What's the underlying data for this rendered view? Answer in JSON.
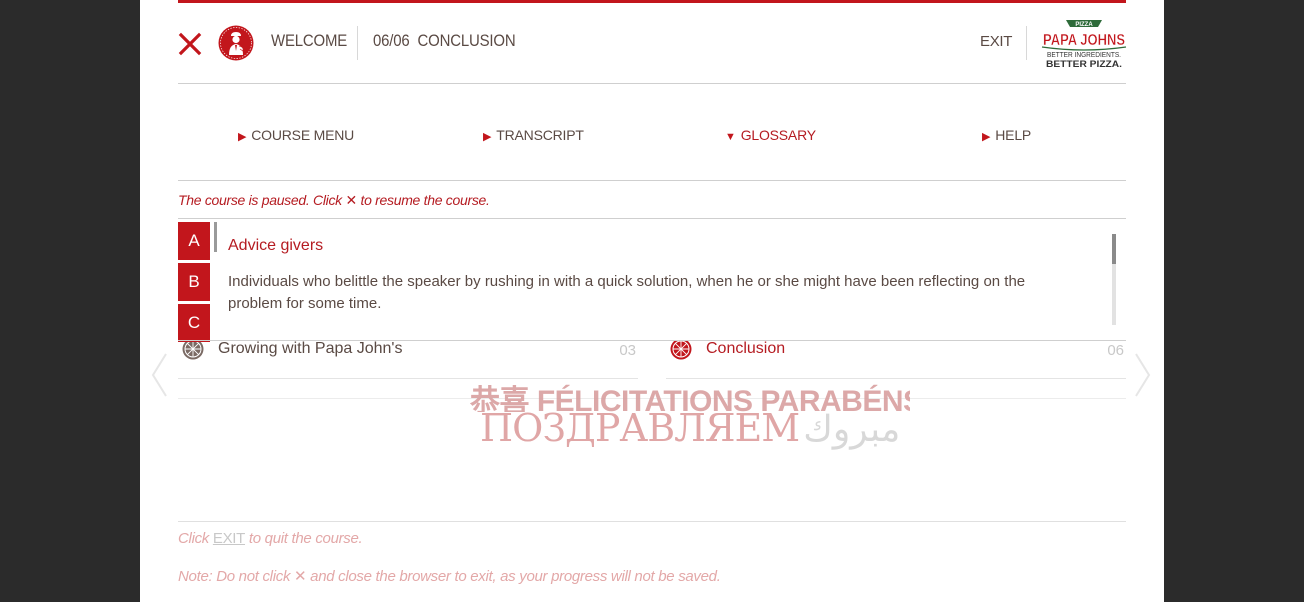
{
  "header": {
    "welcome_label": "WELCOME",
    "step_label": "06/06  CONCLUSION",
    "exit_label": "EXIT",
    "logo": {
      "brand_line": "PAPA JOHNS",
      "badge": "PIZZA",
      "tagline_1": "BETTER INGREDIENTS.",
      "tagline_2": "BETTER PIZZA."
    }
  },
  "nav": {
    "items": [
      {
        "label": "COURSE MENU",
        "state": "collapsed"
      },
      {
        "label": "TRANSCRIPT",
        "state": "collapsed"
      },
      {
        "label": "GLOSSARY",
        "state": "expanded"
      },
      {
        "label": "HELP",
        "state": "collapsed"
      }
    ]
  },
  "paused_notice": {
    "before": "The course is paused. Click ",
    "glyph": "✕",
    "after": " to resume the course."
  },
  "glossary": {
    "letters": [
      "A",
      "B",
      "C"
    ],
    "term": "Advice givers",
    "definition": "Individuals who belittle the speaker by rushing in with a quick solution, when he or she might have been reflecting on the problem for some time."
  },
  "course_menu": {
    "rows": [
      {
        "label": "Growing with Papa John's",
        "number": "03",
        "current": false
      },
      {
        "label": "Conclusion",
        "number": "06",
        "current": true
      }
    ]
  },
  "congrats": {
    "line1": "恭喜  FÉLICITATIONS  PARABÉNS  TEBRİKLER",
    "line2": "ПОЗДРАВЛЯЕМ",
    "line2_arabic": "مبروك"
  },
  "footer": {
    "line1_before": "Click ",
    "line1_link": "EXIT",
    "line1_after": " to quit the course.",
    "line2_before": "Note: Do not click ",
    "line2_glyph": "✕",
    "line2_after": " and close the browser to exit, as your progress will not be saved."
  },
  "colors": {
    "brand_red": "#c2161c",
    "text_brown": "#5a4a44",
    "background": "#2b2b2b",
    "faded_pink": "#e3a8a8"
  },
  "icons": [
    "close-icon",
    "chef-icon",
    "pizza-icon",
    "chevron-left-icon",
    "chevron-right-icon",
    "triangle-right-icon",
    "triangle-down-icon"
  ]
}
